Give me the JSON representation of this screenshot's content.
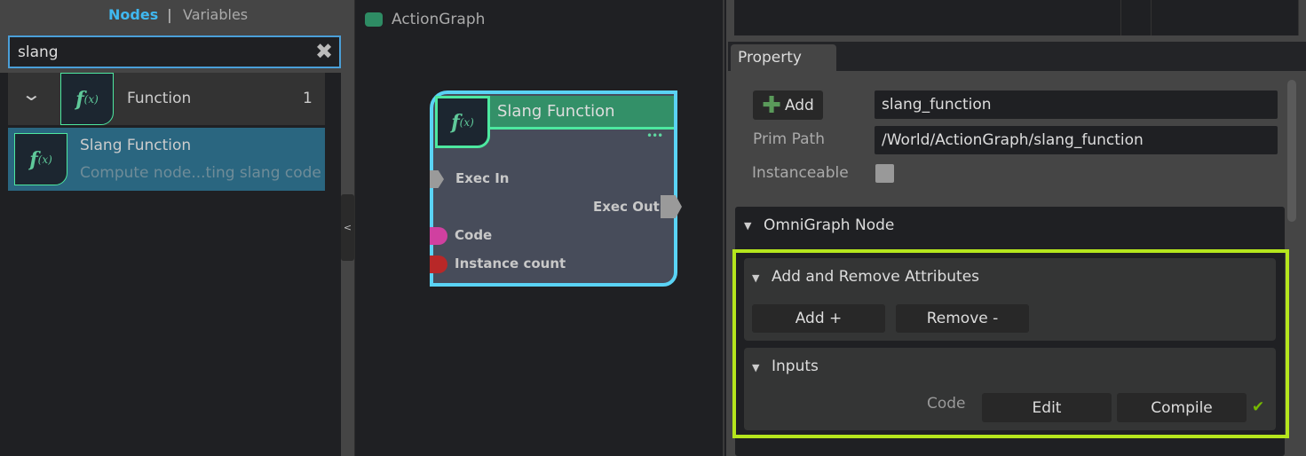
{
  "left_panel": {
    "tabs": {
      "nodes": "Nodes",
      "separator": "|",
      "variables": "Variables"
    },
    "search": {
      "value": "slang",
      "clear_icon": "close-icon"
    },
    "category": {
      "label": "Function",
      "count": "1",
      "icon": "function-icon"
    },
    "results": [
      {
        "title": "Slang Function",
        "description": "Compute node...ting slang code",
        "icon": "function-icon"
      }
    ],
    "splitter_glyph": "<"
  },
  "graph": {
    "title": "ActionGraph",
    "node": {
      "title": "Slang Function",
      "menu": "•••",
      "inputs": [
        {
          "label": "Exec In",
          "color": "#9a9a9a"
        },
        {
          "label": "Code",
          "color": "#d040a0"
        },
        {
          "label": "Instance count",
          "color": "#b82828"
        }
      ],
      "outputs": [
        {
          "label": "Exec Out",
          "color": "#9a9a9a"
        }
      ],
      "header_color": "#339068",
      "border_color": "#5ad3f5"
    }
  },
  "property": {
    "tab": "Property",
    "add_button": "Add",
    "name_value": "slang_function",
    "prim_path_label": "Prim Path",
    "prim_path_value": "/World/ActionGraph/slang_function",
    "instanceable_label": "Instanceable",
    "instanceable_checked": false,
    "omnigraph_section": "OmniGraph Node",
    "attributes_section": "Add and Remove Attributes",
    "add_attr_button": "Add +",
    "remove_attr_button": "Remove -",
    "inputs_section": "Inputs",
    "code_label": "Code",
    "edit_button": "Edit",
    "compile_button": "Compile",
    "status_icon": "check-icon",
    "highlight_color": "#b5e61d"
  }
}
